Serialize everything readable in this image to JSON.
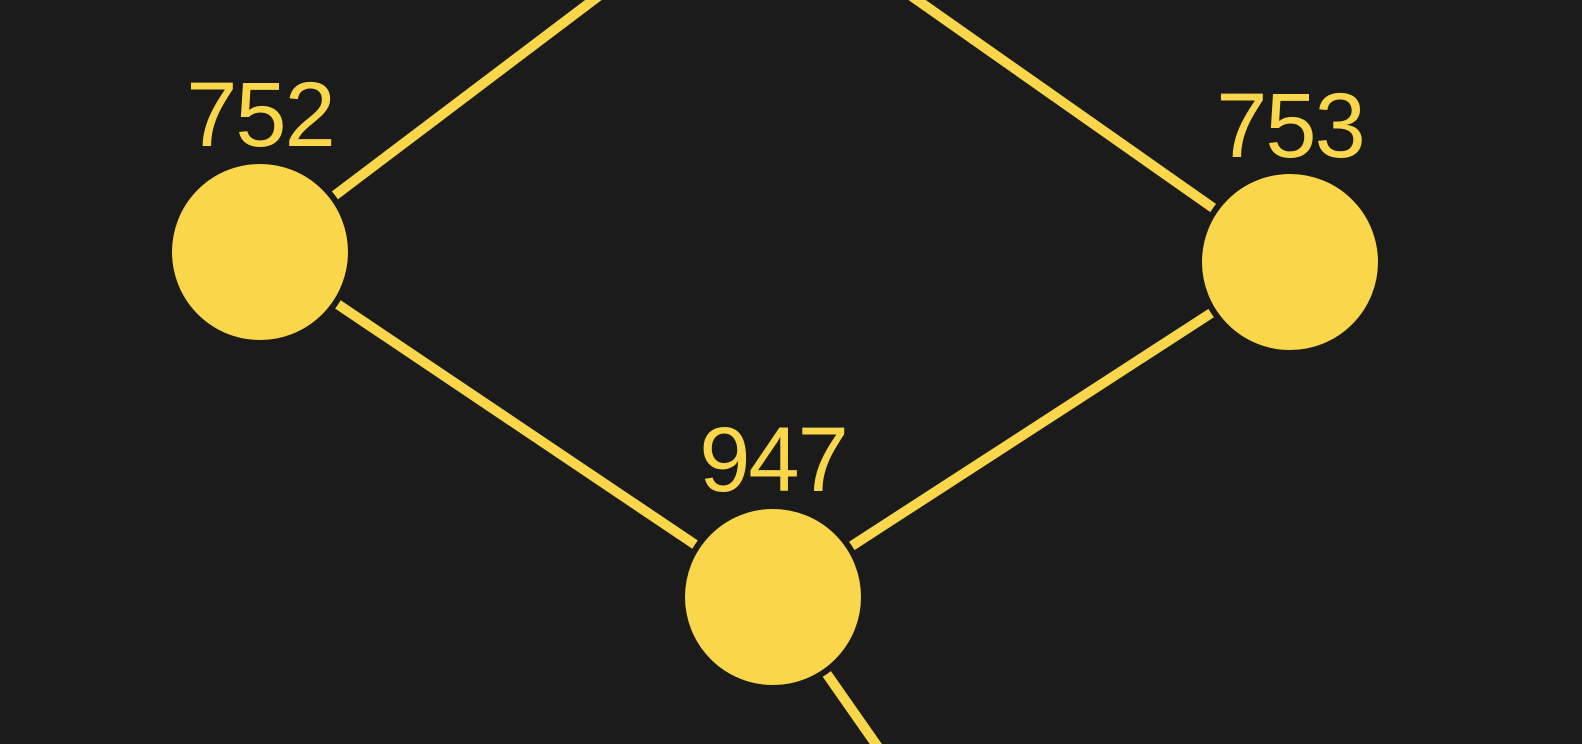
{
  "diagram": {
    "background_color": "#1b1b1b",
    "accent_color": "#f9d64a",
    "nodes": [
      {
        "id": "752",
        "label": "752"
      },
      {
        "id": "753",
        "label": "753"
      },
      {
        "id": "947",
        "label": "947"
      }
    ],
    "edges": [
      {
        "from": "752",
        "to": "offscreen-top"
      },
      {
        "from": "753",
        "to": "offscreen-top"
      },
      {
        "from": "752",
        "to": "947"
      },
      {
        "from": "753",
        "to": "947"
      },
      {
        "from": "947",
        "to": "offscreen-bottom"
      }
    ]
  }
}
